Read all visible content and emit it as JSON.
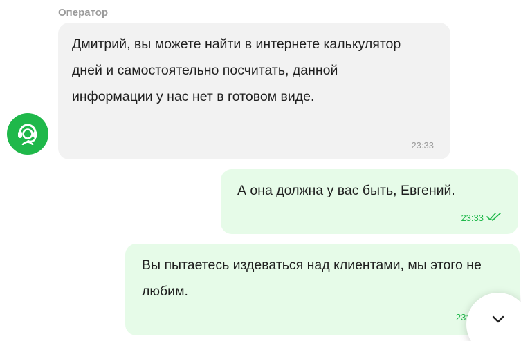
{
  "operator": {
    "label": "Оператор",
    "avatar_icon": "operator-headset-icon"
  },
  "messages": [
    {
      "direction": "incoming",
      "text": "Дмитрий, вы можете найти в интернете калькулятор дней и самостоятельно посчитать, данной информации у нас нет в готовом виде.",
      "time": "23:33"
    },
    {
      "direction": "outgoing",
      "text": "А она должна у вас быть, Евгений.",
      "time": "23:33",
      "status_icon": "double-check-icon"
    },
    {
      "direction": "outgoing",
      "text": "Вы пытаетесь издеваться над клиентами, мы этого не любим.",
      "time": "23:"
    }
  ],
  "scroll_button": {
    "icon": "chevron-down-icon"
  },
  "colors": {
    "accent": "#1fb84a",
    "incoming_bg": "#f2f2f2",
    "outgoing_bg": "#e6fbe8",
    "muted_text": "#9b9b9b"
  }
}
